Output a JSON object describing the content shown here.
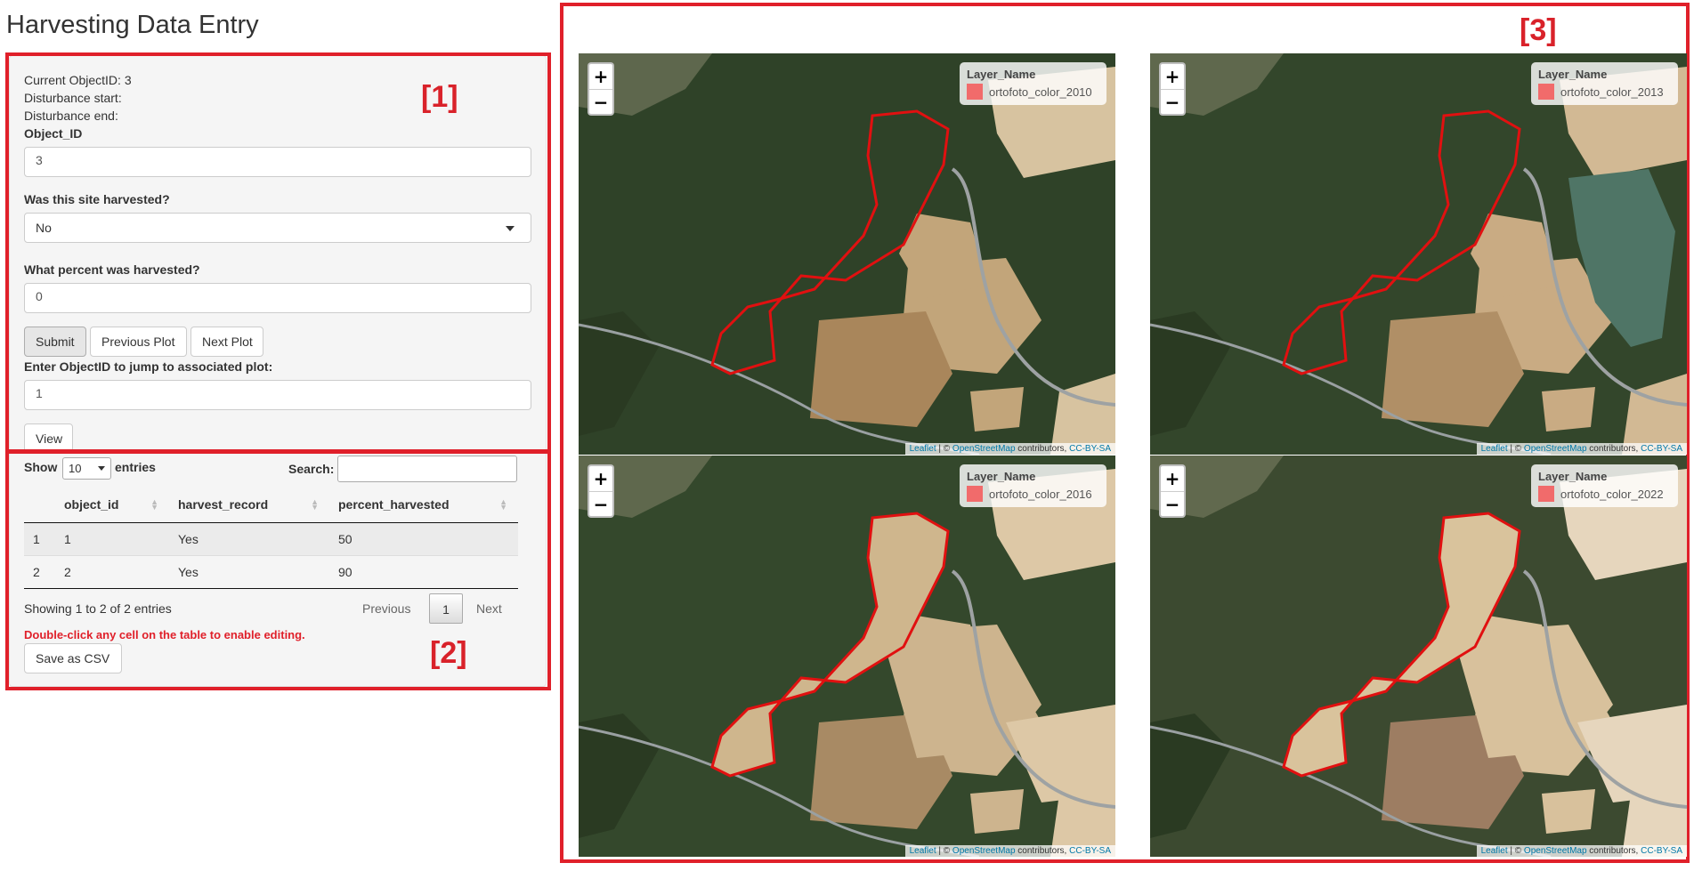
{
  "page": {
    "title": "Harvesting Data Entry"
  },
  "annotations": {
    "box1": "[1]",
    "box2": "[2]",
    "box3": "[3]",
    "color": "#e0202a"
  },
  "form": {
    "current_object_id": "Current ObjectID: 3",
    "disturbance_start": "Disturbance start:",
    "disturbance_end": "Disturbance end:",
    "object_id_label": "Object_ID",
    "object_id_value": "3",
    "harvested_label": "Was this site harvested?",
    "harvested_value": "No",
    "percent_label": "What percent was harvested?",
    "percent_value": "0",
    "submit_label": "Submit",
    "prev_label": "Previous Plot",
    "next_label": "Next Plot",
    "jump_label": "Enter ObjectID to jump to associated plot:",
    "jump_value": "1",
    "view_label": "View"
  },
  "table": {
    "show_label": "Show",
    "page_length": "10",
    "entries_label": "entries",
    "search_label": "Search:",
    "columns": [
      "",
      "object_id",
      "harvest_record",
      "percent_harvested"
    ],
    "rows": [
      [
        "1",
        "1",
        "Yes",
        "50"
      ],
      [
        "2",
        "2",
        "Yes",
        "90"
      ]
    ],
    "info": "Showing 1 to 2 of 2 entries",
    "previous_label": "Previous",
    "current_page": "1",
    "next_label": "Next",
    "edit_hint": "Double-click any cell on the table to enable editing.",
    "save_csv_label": "Save as CSV"
  },
  "maps": [
    {
      "legend_title": "Layer_Name",
      "layer": "ortofoto_color_2010",
      "swatch_color": "#f16b6b"
    },
    {
      "legend_title": "Layer_Name",
      "layer": "ortofoto_color_2013",
      "swatch_color": "#f16b6b"
    },
    {
      "legend_title": "Layer_Name",
      "layer": "ortofoto_color_2016",
      "swatch_color": "#f16b6b"
    },
    {
      "legend_title": "Layer_Name",
      "layer": "ortofoto_color_2022",
      "swatch_color": "#f16b6b"
    }
  ],
  "map_controls": {
    "zoom_in": "+",
    "zoom_out": "−"
  },
  "attribution": {
    "leaflet": "Leaflet",
    "sep1": " | © ",
    "osm": "OpenStreetMap",
    "contrib": " contributors, ",
    "license": "CC-BY-SA"
  }
}
